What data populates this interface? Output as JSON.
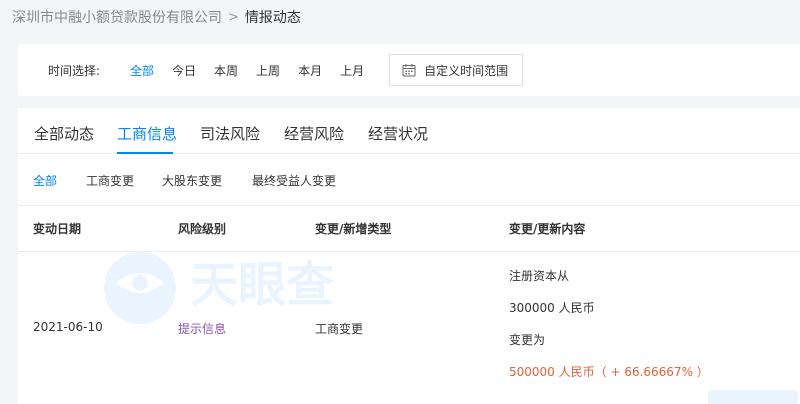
{
  "breadcrumb": {
    "company": "深圳市中融小额贷款股份有限公司",
    "separator": ">",
    "current": "情报动态"
  },
  "time_filter": {
    "label": "时间选择:",
    "options": [
      "全部",
      "今日",
      "本周",
      "上周",
      "本月",
      "上月"
    ],
    "selected": "全部",
    "custom_range_label": "自定义时间范围",
    "custom_range_icon": "calendar-icon"
  },
  "tabs": {
    "items": [
      "全部动态",
      "工商信息",
      "司法风险",
      "经营风险",
      "经营状况"
    ],
    "active": "工商信息"
  },
  "subtabs": {
    "items": [
      "全部",
      "工商变更",
      "大股东变更",
      "最终受益人变更"
    ],
    "active": "全部"
  },
  "table": {
    "columns": [
      "变动日期",
      "风险级别",
      "变更/新增类型",
      "变更/更新内容"
    ],
    "rows": [
      {
        "date": "2021-06-10",
        "risk_level": "提示信息",
        "type": "工商变更",
        "content": {
          "line1": "注册资本从",
          "line2": "300000 人民币",
          "line3": "变更为",
          "line4": "500000 人民币（ + 66.66667% ）"
        }
      }
    ]
  },
  "watermark_text": "天眼查",
  "colors": {
    "accent": "#0084ff",
    "risk_info": "#8a55b8",
    "increase": "#e0623b",
    "page_bg": "#f4f5f7"
  }
}
